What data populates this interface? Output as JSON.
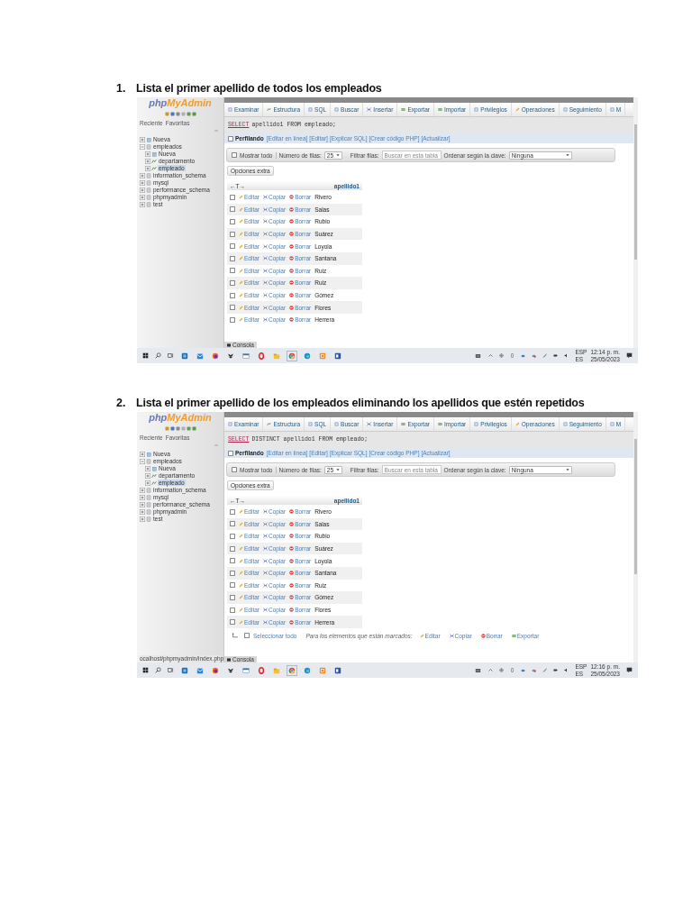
{
  "exercises": [
    {
      "number": "1.",
      "title": "Lista el primer apellido de todos los empleados",
      "screen": {
        "logo": {
          "first": "php",
          "second": "MyAdmin"
        },
        "panel_tabs": [
          "Reciente",
          "Favoritas"
        ],
        "tree": [
          {
            "label": "Nueva",
            "expanded": false,
            "selected": false
          },
          {
            "label": "empleados",
            "expanded": true,
            "selected": false,
            "children": [
              {
                "label": "Nueva",
                "expanded": false,
                "selected": false
              },
              {
                "label": "departamento",
                "expanded": false,
                "selected": false
              },
              {
                "label": "empleado",
                "expanded": false,
                "selected": true
              }
            ]
          },
          {
            "label": "information_schema",
            "expanded": false,
            "selected": false
          },
          {
            "label": "mysql",
            "expanded": false,
            "selected": false
          },
          {
            "label": "performance_schema",
            "expanded": false,
            "selected": false
          },
          {
            "label": "phpmyadmin",
            "expanded": false,
            "selected": false
          },
          {
            "label": "test",
            "expanded": false,
            "selected": false
          }
        ],
        "tabs": [
          "Examinar",
          "Estructura",
          "SQL",
          "Buscar",
          "Insertar",
          "Exportar",
          "Importar",
          "Privilegios",
          "Operaciones",
          "Seguimiento",
          "M"
        ],
        "query": {
          "keyword": "SELECT",
          "rest": "apellido1 FROM empleado;"
        },
        "profiling": {
          "label": "Perfilando",
          "checked": false,
          "links": [
            "[Editar en línea]",
            "[Editar]",
            "[Explicar SQL]",
            "[Crear código PHP]",
            "[Actualizar]"
          ]
        },
        "controls": {
          "show_all": {
            "label": "Mostrar todo",
            "checked": false
          },
          "rows_label": "Número de filas:",
          "rows_value": "25",
          "filter_label": "Filtrar filas:",
          "filter_placeholder": "Buscar en esta tabla",
          "sort_label": "Ordenar según la clave:",
          "sort_value": "Ninguna"
        },
        "extra_options": "Opciones extra",
        "table": {
          "arrows": "←T→",
          "column": "apellido1",
          "rows": [
            {
              "actions": [
                "Editar",
                "Copiar",
                "Borrar"
              ],
              "value": "Rivero",
              "checked": false
            },
            {
              "actions": [
                "Editar",
                "Copiar",
                "Borrar"
              ],
              "value": "Salas",
              "checked": false
            },
            {
              "actions": [
                "Editar",
                "Copiar",
                "Borrar"
              ],
              "value": "Rubio",
              "checked": false
            },
            {
              "actions": [
                "Editar",
                "Copiar",
                "Borrar"
              ],
              "value": "Suárez",
              "checked": false
            },
            {
              "actions": [
                "Editar",
                "Copiar",
                "Borrar"
              ],
              "value": "Loyola",
              "checked": false
            },
            {
              "actions": [
                "Editar",
                "Copiar",
                "Borrar"
              ],
              "value": "Santana",
              "checked": false
            },
            {
              "actions": [
                "Editar",
                "Copiar",
                "Borrar"
              ],
              "value": "Ruiz",
              "checked": false
            },
            {
              "actions": [
                "Editar",
                "Copiar",
                "Borrar"
              ],
              "value": "Ruiz",
              "checked": false
            },
            {
              "actions": [
                "Editar",
                "Copiar",
                "Borrar"
              ],
              "value": "Gómez",
              "checked": false
            },
            {
              "actions": [
                "Editar",
                "Copiar",
                "Borrar"
              ],
              "value": "Flores",
              "checked": false
            },
            {
              "actions": [
                "Editar",
                "Copiar",
                "Borrar"
              ],
              "value": "Herrera",
              "checked": false
            }
          ]
        },
        "console": "Consola",
        "taskbar": {
          "language": "ESP",
          "layout": "ES",
          "time": "12:14 p. m.",
          "date": "25/05/2023"
        }
      }
    },
    {
      "number": "2.",
      "title": "Lista el primer apellido de los empleados eliminando los apellidos que estén repetidos",
      "screen": {
        "logo": {
          "first": "php",
          "second": "MyAdmin"
        },
        "panel_tabs": [
          "Reciente",
          "Favoritas"
        ],
        "tree": [
          {
            "label": "Nueva",
            "expanded": false,
            "selected": false
          },
          {
            "label": "empleados",
            "expanded": true,
            "selected": false,
            "children": [
              {
                "label": "Nueva",
                "expanded": false,
                "selected": false
              },
              {
                "label": "departamento",
                "expanded": false,
                "selected": false
              },
              {
                "label": "empleado",
                "expanded": false,
                "selected": true
              }
            ]
          },
          {
            "label": "information_schema",
            "expanded": false,
            "selected": false
          },
          {
            "label": "mysql",
            "expanded": false,
            "selected": false
          },
          {
            "label": "performance_schema",
            "expanded": false,
            "selected": false
          },
          {
            "label": "phpmyadmin",
            "expanded": false,
            "selected": false
          },
          {
            "label": "test",
            "expanded": false,
            "selected": false
          }
        ],
        "tabs": [
          "Examinar",
          "Estructura",
          "SQL",
          "Buscar",
          "Insertar",
          "Exportar",
          "Importar",
          "Privilegios",
          "Operaciones",
          "Seguimiento",
          "M"
        ],
        "query": {
          "keyword": "SELECT",
          "rest": "DISTINCT apellido1 FROM empleado;"
        },
        "profiling": {
          "label": "Perfilando",
          "checked": false,
          "links": [
            "[Editar en línea]",
            "[Editar]",
            "[Explicar SQL]",
            "[Crear código PHP]",
            "[Actualizar]"
          ]
        },
        "controls": {
          "show_all": {
            "label": "Mostrar todo",
            "checked": false
          },
          "rows_label": "Número de filas:",
          "rows_value": "25",
          "filter_label": "Filtrar filas:",
          "filter_placeholder": "Buscar en esta tabla",
          "sort_label": "Ordenar según la clave:",
          "sort_value": "Ninguna"
        },
        "extra_options": "Opciones extra",
        "table": {
          "arrows": "←T→",
          "column": "apellido1",
          "rows": [
            {
              "actions": [
                "Editar",
                "Copiar",
                "Borrar"
              ],
              "value": "Rivero",
              "checked": false
            },
            {
              "actions": [
                "Editar",
                "Copiar",
                "Borrar"
              ],
              "value": "Salas",
              "checked": false
            },
            {
              "actions": [
                "Editar",
                "Copiar",
                "Borrar"
              ],
              "value": "Rubio",
              "checked": false
            },
            {
              "actions": [
                "Editar",
                "Copiar",
                "Borrar"
              ],
              "value": "Suárez",
              "checked": false
            },
            {
              "actions": [
                "Editar",
                "Copiar",
                "Borrar"
              ],
              "value": "Loyola",
              "checked": false
            },
            {
              "actions": [
                "Editar",
                "Copiar",
                "Borrar"
              ],
              "value": "Santana",
              "checked": false
            },
            {
              "actions": [
                "Editar",
                "Copiar",
                "Borrar"
              ],
              "value": "Ruiz",
              "checked": false
            },
            {
              "actions": [
                "Editar",
                "Copiar",
                "Borrar"
              ],
              "value": "Gómez",
              "checked": false
            },
            {
              "actions": [
                "Editar",
                "Copiar",
                "Borrar"
              ],
              "value": "Flores",
              "checked": false
            },
            {
              "actions": [
                "Editar",
                "Copiar",
                "Borrar"
              ],
              "value": "Herrera",
              "checked": false
            }
          ]
        },
        "footer": {
          "select_all": {
            "label": "Seleccionar todo",
            "checked": false
          },
          "marked_label": "Para los elementos que están marcados:",
          "actions": [
            "Editar",
            "Copiar",
            "Borrar",
            "Exportar"
          ]
        },
        "status_url": "ocalhost/phpmyadmin/index.php",
        "console": "Consola",
        "taskbar": {
          "language": "ESP",
          "layout": "ES",
          "time": "12:16 p. m.",
          "date": "25/05/2023"
        }
      }
    }
  ]
}
